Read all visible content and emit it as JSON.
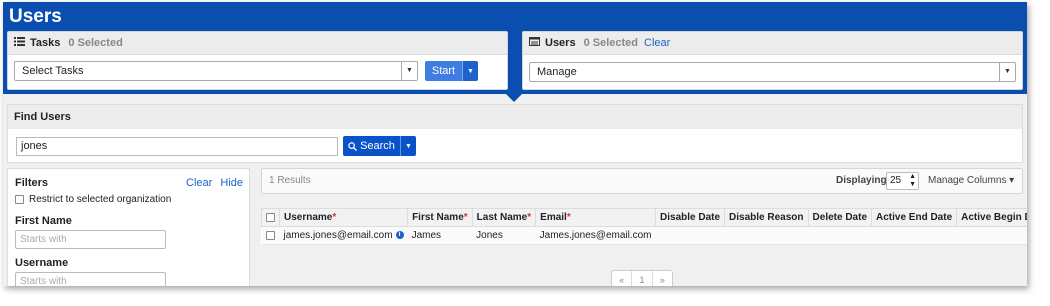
{
  "page": {
    "title": "Users"
  },
  "tasks_panel": {
    "title": "Tasks",
    "selected": "0 Selected",
    "select_value": "Select Tasks",
    "start_label": "Start"
  },
  "users_panel": {
    "title": "Users",
    "selected": "0 Selected",
    "clear_label": "Clear",
    "select_value": "Manage"
  },
  "find": {
    "title": "Find Users",
    "query": "jones",
    "search_label": "Search"
  },
  "filters": {
    "title": "Filters",
    "clear_label": "Clear",
    "hide_label": "Hide",
    "restrict_label": "Restrict to selected organization",
    "first_name_label": "First Name",
    "first_name_placeholder": "Starts with",
    "username_label": "Username",
    "username_placeholder": "Starts with"
  },
  "results": {
    "count": "1 Results",
    "displaying_label": "Displaying",
    "page_size": "25",
    "manage_columns_label": "Manage Columns",
    "columns": [
      "Username",
      "First Name",
      "Last Name",
      "Email",
      "Disable Date",
      "Disable Reason",
      "Delete Date",
      "Active End Date",
      "Active Begin Date"
    ],
    "required_columns": [
      "Username",
      "First Name",
      "Last Name",
      "Email"
    ],
    "rows": [
      {
        "username": "james.jones@email.com",
        "first_name": "James",
        "last_name": "Jones",
        "email": "James.jones@email.com",
        "disable_date": "",
        "disable_reason": "",
        "delete_date": "",
        "active_end_date": "",
        "active_begin_date": ""
      }
    ],
    "pager": {
      "prev": "«",
      "page": "1",
      "next": "»"
    }
  },
  "colors": {
    "banner": "#0a4fb0",
    "accent": "#1a63c6",
    "required": "#d9302c"
  },
  "icons": {
    "tasks": "task-list-icon",
    "users": "user-list-icon",
    "search": "search-icon",
    "info": "info-icon"
  }
}
